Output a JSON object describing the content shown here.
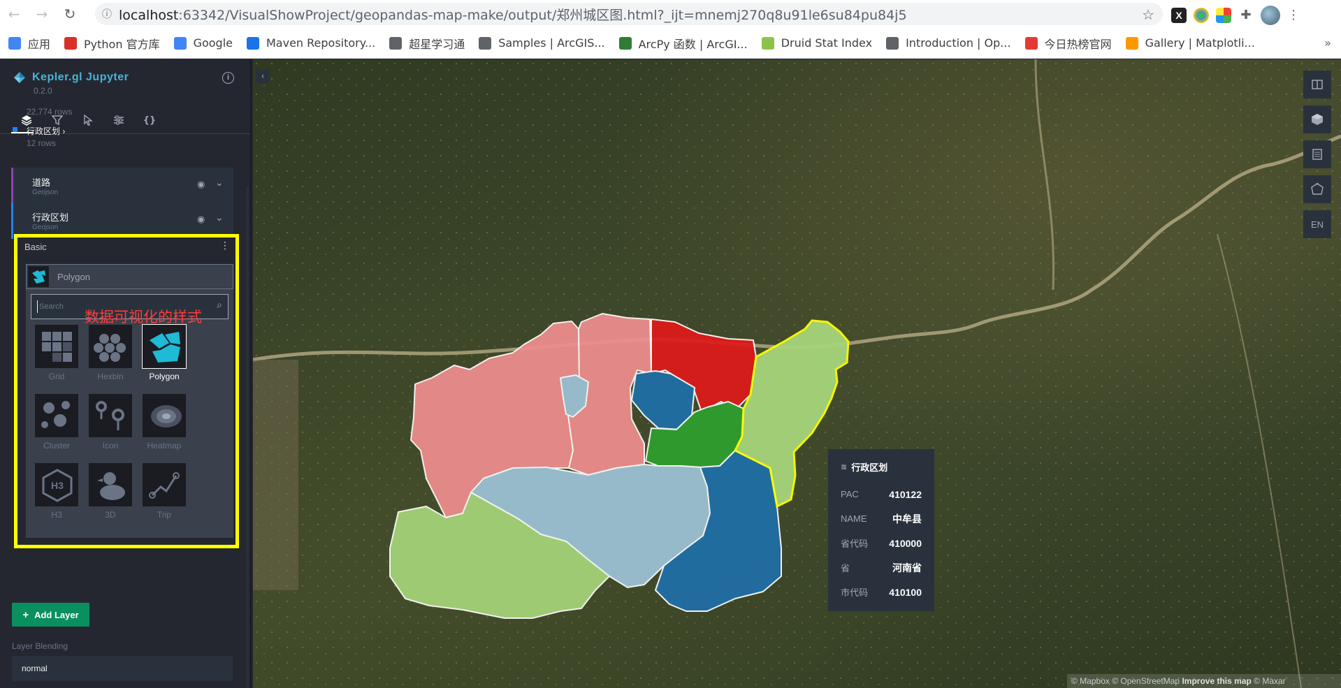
{
  "browser": {
    "url_host": "localhost",
    "url_path": ":63342/VisualShowProject/geopandas-map-make/output/郑州城区图.html?_ijt=mnemj270q8u91le6su84pu84j5",
    "bookmarks": [
      {
        "label": "应用",
        "icon": "apps-grid-icon",
        "color": "#4285f4"
      },
      {
        "label": "Python 官方库",
        "icon": "python-icon",
        "color": "#d93025"
      },
      {
        "label": "Google",
        "icon": "google-icon",
        "color": "#4285f4"
      },
      {
        "label": "Maven Repository...",
        "icon": "maven-icon",
        "color": "#1a73e8"
      },
      {
        "label": "超星学习通",
        "icon": "globe-icon",
        "color": "#5f6368"
      },
      {
        "label": "Samples | ArcGIS...",
        "icon": "globe-icon",
        "color": "#5f6368"
      },
      {
        "label": "ArcPy 函数 | ArcGI...",
        "icon": "arcgis-icon",
        "color": "#2e7d32"
      },
      {
        "label": "Druid Stat Index",
        "icon": "leaf-icon",
        "color": "#8bc34a"
      },
      {
        "label": "Introduction | Op...",
        "icon": "book-icon",
        "color": "#5f6368"
      },
      {
        "label": "今日热榜官网",
        "icon": "r-icon",
        "color": "#e53935"
      },
      {
        "label": "Gallery | Matplotli...",
        "icon": "matplotlib-icon",
        "color": "#ff9800"
      }
    ],
    "more": "»"
  },
  "app": {
    "title": "Kepler.gl Jupyter",
    "version": "0.2.0",
    "accent": "#47b3d7"
  },
  "datasets": {
    "prev_rows": "22,774 rows",
    "admin_name": "行政区划",
    "admin_rows": "12 rows"
  },
  "layers": [
    {
      "name": "道路",
      "type": "Geojson",
      "color": "#8e44ad"
    },
    {
      "name": "行政区划",
      "type": "Geojson",
      "color": "#1f80ff"
    }
  ],
  "basic": {
    "title": "Basic",
    "selected_type": "Polygon",
    "search_placeholder": "Search",
    "annotation": "数据可视化的样式",
    "highlight_color": "#ffff00",
    "layer_types": [
      "Grid",
      "Hexbin",
      "Polygon",
      "Cluster",
      "Icon",
      "Heatmap",
      "H3",
      "3D",
      "Trip"
    ]
  },
  "add_layer_label": "Add Layer",
  "blending": {
    "label": "Layer Blending",
    "value": "normal"
  },
  "map_controls": {
    "locale": "EN"
  },
  "tooltip": {
    "layer": "行政区划",
    "rows": [
      {
        "key": "PAC",
        "value": "410122"
      },
      {
        "key": "NAME",
        "value": "中牟县"
      },
      {
        "key": "省代码",
        "value": "410000"
      },
      {
        "key": "省",
        "value": "河南省"
      },
      {
        "key": "市代码",
        "value": "410100"
      }
    ]
  },
  "attribution": {
    "text": "© Mapbox © OpenStreetMap",
    "improve": "Improve this map",
    "maxar": "© Maxar"
  },
  "region_colors": {
    "pink": "#f08e8e",
    "red": "#e01a1a",
    "darkblue": "#1f6fa8",
    "lightblue": "#9ec4d8",
    "green": "#2ea02e",
    "lightgreen": "#a6d57a",
    "outline_selected": "#ffff00"
  }
}
